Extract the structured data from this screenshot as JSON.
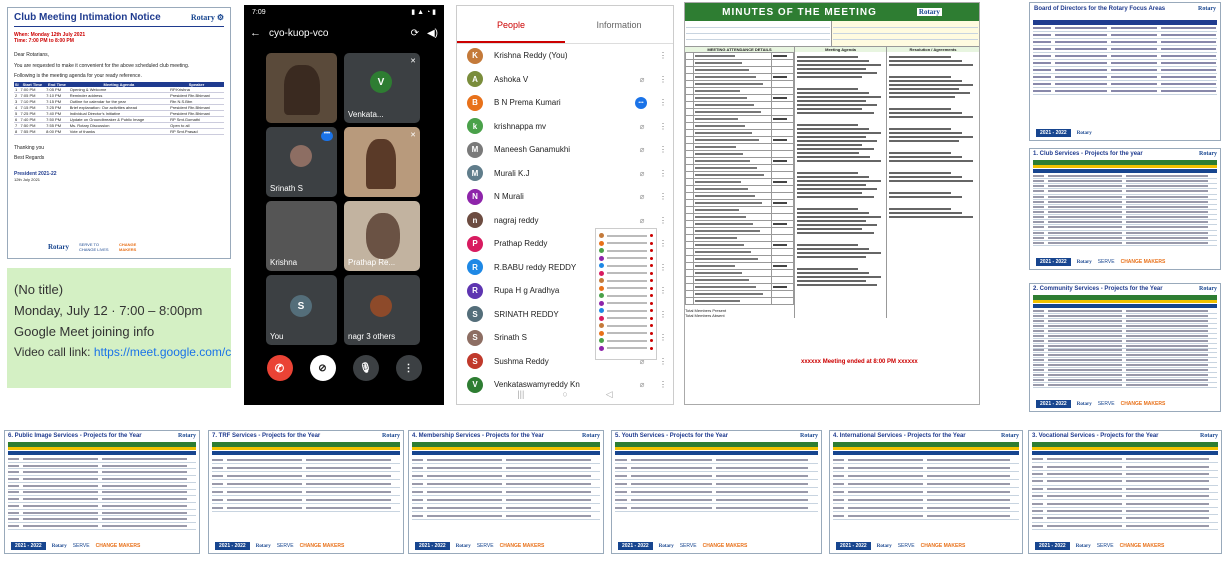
{
  "intimation": {
    "title": "Club Meeting Intimation Notice",
    "when": "When: Monday 12th July 2021",
    "time": "Time: 7:00 PM to 8:00 PM",
    "greeting": "Dear Rotarians,",
    "body1": "You are requested to make it convenient for the above scheduled club meeting.",
    "body2": "Following is the meeting agenda for your ready reference.",
    "table_headers": [
      "Sl",
      "Start Time",
      "End Time",
      "Meeting Agenda",
      "Speaker"
    ],
    "rows": [
      [
        "1",
        "7:00 PM",
        "7:05 PM",
        "Opening & Welcome",
        "RP.Krishna"
      ],
      [
        "2",
        "7:05 PM",
        "7:10 PM",
        "Reminder address",
        "President Rtn.Bhimani"
      ],
      [
        "3",
        "7:10 PM",
        "7:15 PM",
        "Outline for calendar for the year",
        "Rtn N.S.Btm"
      ],
      [
        "4",
        "7:15 PM",
        "7:25 PM",
        "Brief explanation: Our activities ahead",
        "President Rtn.Bhimani"
      ],
      [
        "5",
        "7:25 PM",
        "7:40 PM",
        "Individual Director's Initiative",
        "President Rtn.Bhimani"
      ],
      [
        "6",
        "7:40 PM",
        "7:50 PM",
        "Update on Groundbreaker & Public Image",
        "RP Smt.Gomathi"
      ],
      [
        "7",
        "7:50 PM",
        "7:55 PM",
        "Ms. Rotary Discussion",
        "Open to all"
      ],
      [
        "8",
        "7:55 PM",
        "8:00 PM",
        "Vote of thanks",
        "RP Smt.Prasad"
      ]
    ],
    "thanking": "Thanking you",
    "regards": "Best Regards",
    "sign": "President 2021-22",
    "date": "12th July 2021",
    "footer_rotary": "Rotary",
    "footer_logo2": "SERVE TO CHANGE LIVES",
    "footer_logo3": "CHANGE MAKERS"
  },
  "calendar_card": {
    "title": "(No title)",
    "when": "Monday, July 12 · 7:00 – 8:00pm",
    "info": "Google Meet joining info",
    "link_label": "Video call link:",
    "link": "https://meet.google.com/cyo-kuop-vco"
  },
  "phone": {
    "time": "7:09",
    "code": "cyo-kuop-vco",
    "tiles": [
      {
        "name": "Venkata...",
        "initial": "V"
      },
      {
        "name": "Srinath S"
      },
      {
        "name": "..."
      },
      {
        "name": "Krishna"
      },
      {
        "name": "Prathap Re..."
      },
      {
        "name": "You",
        "initial": "S"
      },
      {
        "name": "nagr  3 others"
      }
    ]
  },
  "people": {
    "tab_people": "People",
    "tab_info": "Information",
    "list": [
      {
        "name": "Krishna Reddy (You)",
        "initial": "K",
        "color": "#c47a3a",
        "photo": true
      },
      {
        "name": "Ashoka V",
        "initial": "A",
        "color": "#7a8d3c",
        "photo": true
      },
      {
        "name": "B N Prema Kumari",
        "initial": "B",
        "color": "#e8711a"
      },
      {
        "name": "krishnappa mv",
        "initial": "k",
        "color": "#4aa14a"
      },
      {
        "name": "Maneesh Ganamukhi",
        "initial": "M",
        "color": "#7a7a7a",
        "photo": true
      },
      {
        "name": "Murali K.J",
        "initial": "M",
        "color": "#607d8b"
      },
      {
        "name": "N Murali",
        "initial": "N",
        "color": "#8e24aa"
      },
      {
        "name": "nagraj reddy",
        "initial": "n",
        "color": "#6d4c41",
        "photo": true
      },
      {
        "name": "Prathap Reddy",
        "initial": "P",
        "color": "#d81b60"
      },
      {
        "name": "R.BABU reddy REDDY",
        "initial": "R",
        "color": "#1e88e5"
      },
      {
        "name": "Rupa H g Aradhya",
        "initial": "R",
        "color": "#5e35b1"
      },
      {
        "name": "SRINATH REDDY",
        "initial": "S",
        "color": "#546e7a"
      },
      {
        "name": "Srinath S",
        "initial": "S",
        "color": "#8d6e63",
        "photo": true
      },
      {
        "name": "Sushma Reddy",
        "initial": "S",
        "color": "#c0392b",
        "photo": true
      },
      {
        "name": "Venkataswamyreddy Kn",
        "initial": "V",
        "color": "#2e7d32"
      }
    ]
  },
  "minutes": {
    "title": "MINUTES OF THE MEETING",
    "attendance_title": "MEETING ATTENDANCE DETAILS",
    "agenda_header": "Meeting Agenda",
    "resolution_header": "Resolution / Agreements",
    "ended": "Meeting ended at 8:00 PM",
    "total_present": "Total Members Present",
    "total_absent": "Total Members Absent"
  },
  "board": {
    "title": "Board of Directors for the Rotary Focus Areas",
    "year": "2021 - 2022"
  },
  "cards": [
    {
      "title": "1. Club Services - Projects for the year",
      "year": "2021 - 2022"
    },
    {
      "title": "2. Community Services - Projects for the Year",
      "year": "2021 - 2022"
    },
    {
      "title": "6. Public Image Services - Projects for the Year",
      "year": "2021 - 2022"
    },
    {
      "title": "7. TRF Services - Projects for the Year",
      "year": "2021 - 2022"
    },
    {
      "title": "4. Membership Services - Projects for the Year",
      "year": "2021 - 2022"
    },
    {
      "title": "5. Youth Services - Projects for the Year",
      "year": "2021 - 2022"
    },
    {
      "title": "4. International Services - Projects for the Year",
      "year": "2021 - 2022"
    },
    {
      "title": "3. Vocational Services - Projects for the Year",
      "year": "2021 - 2022"
    }
  ]
}
